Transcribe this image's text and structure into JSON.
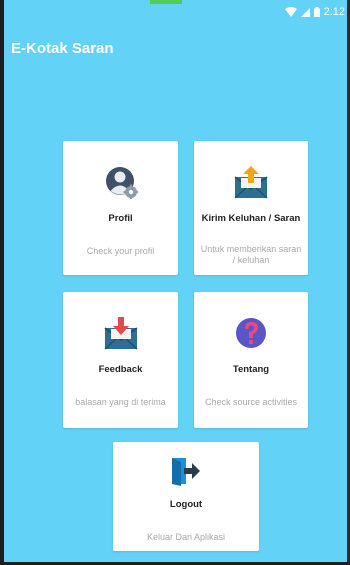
{
  "status_bar": {
    "time": "2:12",
    "icons": [
      "wifi-icon",
      "signal-icon",
      "battery-icon"
    ]
  },
  "app_bar": {
    "title": "E-Kotak Saran"
  },
  "colors": {
    "background": "#62d2f6",
    "card": "#ffffff",
    "title_text": "#222222",
    "subtitle_text": "#a8a8a8"
  },
  "menu": {
    "profil": {
      "icon": "user-settings-icon",
      "title": "Profil",
      "subtitle": "Check your profil"
    },
    "kirim": {
      "icon": "envelope-upload-icon",
      "title": "Kirim Keluhan / Saran",
      "subtitle": "Untuk memberikan saran / keluhan"
    },
    "feedback": {
      "icon": "envelope-download-icon",
      "title": "Feedback",
      "subtitle": "balasan yang di terima"
    },
    "tentang": {
      "icon": "question-icon",
      "title": "Tentang",
      "subtitle": "Check source activities"
    },
    "logout": {
      "icon": "logout-icon",
      "title": "Logout",
      "subtitle": "Keluar Dari Aplikasi"
    }
  }
}
